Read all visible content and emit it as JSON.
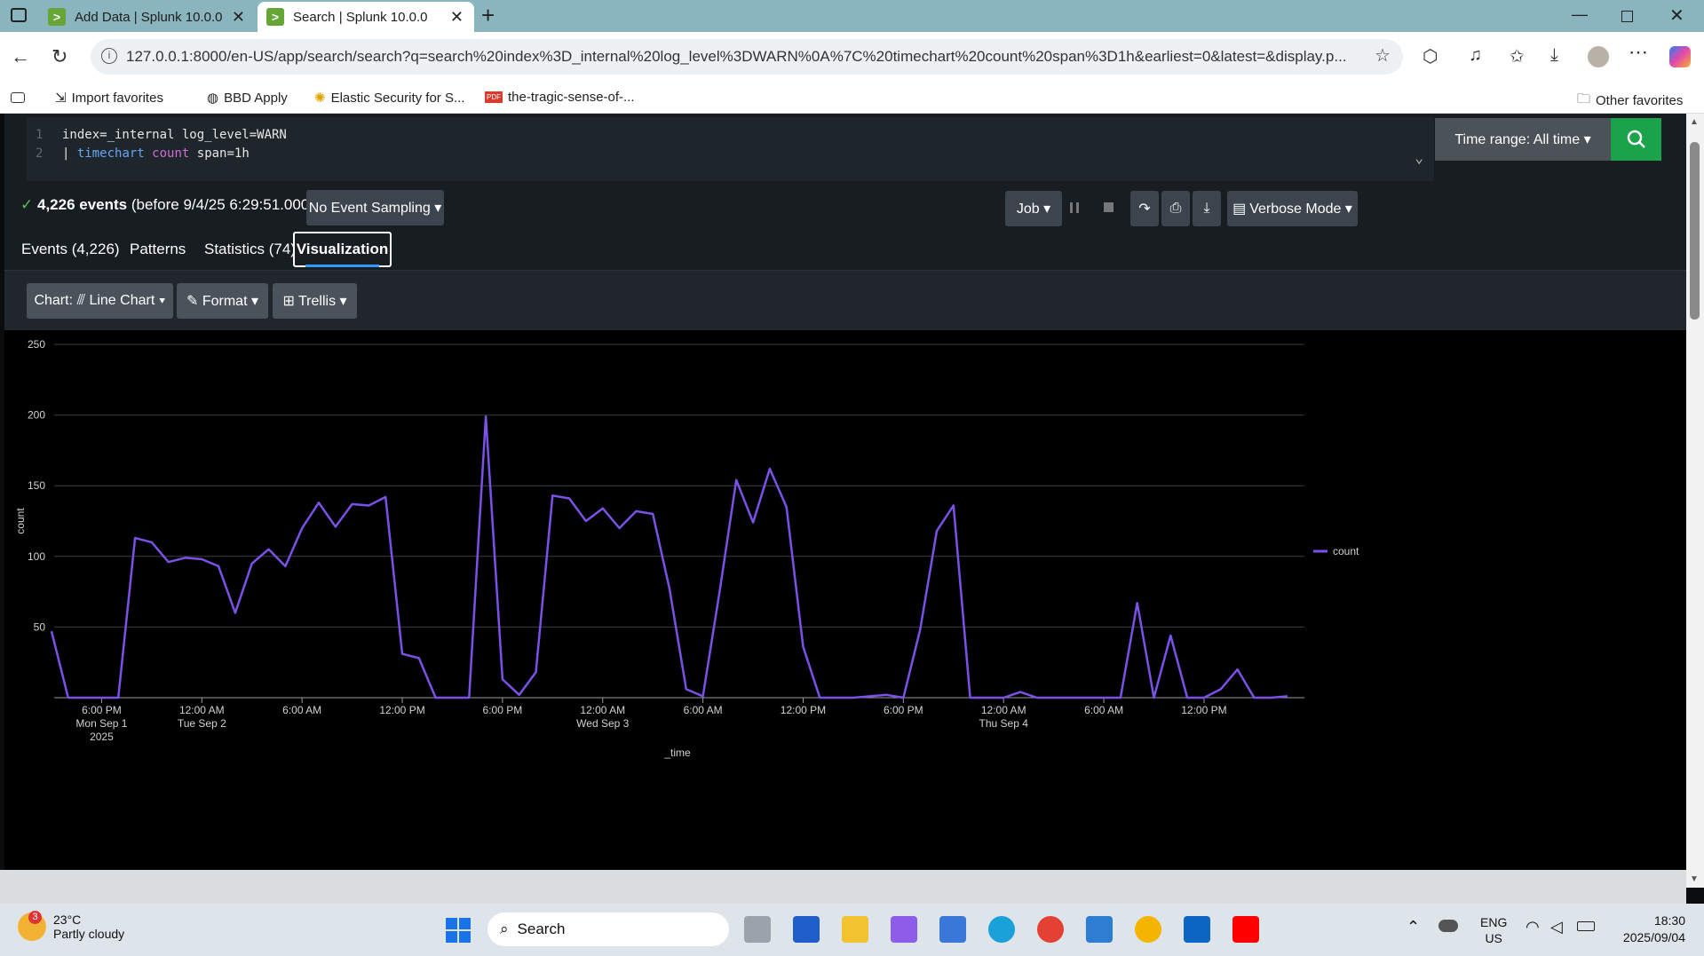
{
  "browser": {
    "tabs": [
      {
        "title": "Add Data | Splunk 10.0.0"
      },
      {
        "title": "Search | Splunk 10.0.0"
      }
    ],
    "url": "127.0.0.1:8000/en-US/app/search/search?q=search%20index%3D_internal%20log_level%3DWARN%0A%7C%20timechart%20count%20span%3D1h&earliest=0&latest=&display.p...",
    "bookmarks": [
      "Import favorites",
      "BBD Apply",
      "Elastic Security for S...",
      "the-tragic-sense-of-..."
    ],
    "other_favorites": "Other favorites"
  },
  "search": {
    "line1": "index=_internal log_level=WARN",
    "line2_pipe": "|",
    "line2_cmd": "timechart",
    "line2_arg": "count",
    "line2_rest": "span=1h",
    "time_range": "Time range: All time ▾"
  },
  "status": {
    "check": "✓",
    "events_bold": "4,226 events",
    "events_rest": "(before 9/4/25 6:29:51.000 PM)",
    "sampling": "No Event Sampling ▾",
    "job": "Job ▾",
    "mode": "Verbose Mode ▾"
  },
  "tabs": [
    "Events (4,226)",
    "Patterns",
    "Statistics (74)",
    "Visualization"
  ],
  "toolbar": {
    "chart": "Chart: ⫻ Line Chart ▾",
    "format": "✎ Format ▾",
    "trellis": "⊞ Trellis ▾"
  },
  "chart_data": {
    "type": "line",
    "xlabel": "_time",
    "ylabel": "count",
    "ylim": [
      0,
      250
    ],
    "yticks": [
      50,
      100,
      150,
      200,
      250
    ],
    "legend": "right",
    "grid": true,
    "color": "#7b52e8",
    "series": [
      {
        "name": "count",
        "values": [
          47,
          0,
          0,
          0,
          0,
          113,
          110,
          96,
          99,
          98,
          93,
          60,
          95,
          105,
          93,
          120,
          138,
          121,
          137,
          136,
          142,
          31,
          28,
          0,
          0,
          0,
          199,
          13,
          2,
          18,
          143,
          141,
          125,
          134,
          120,
          132,
          130,
          77,
          6,
          1,
          75,
          154,
          124,
          162,
          135,
          36,
          0,
          0,
          0,
          1,
          2,
          0,
          48,
          118,
          136,
          0,
          0,
          0,
          4,
          0,
          0,
          0,
          0,
          0,
          0,
          67,
          0,
          44,
          0,
          0,
          6,
          20,
          0,
          0,
          1
        ]
      }
    ],
    "xticks": [
      {
        "i": 3,
        "label": "6:00 PM",
        "sub": "Mon Sep 1",
        "sub2": "2025"
      },
      {
        "i": 9,
        "label": "12:00 AM",
        "sub": "Tue Sep 2",
        "sub2": ""
      },
      {
        "i": 15,
        "label": "6:00 AM",
        "sub": "",
        "sub2": ""
      },
      {
        "i": 21,
        "label": "12:00 PM",
        "sub": "",
        "sub2": ""
      },
      {
        "i": 27,
        "label": "6:00 PM",
        "sub": "",
        "sub2": ""
      },
      {
        "i": 33,
        "label": "12:00 AM",
        "sub": "Wed Sep 3",
        "sub2": ""
      },
      {
        "i": 39,
        "label": "6:00 AM",
        "sub": "",
        "sub2": ""
      },
      {
        "i": 45,
        "label": "12:00 PM",
        "sub": "",
        "sub2": ""
      },
      {
        "i": 51,
        "label": "6:00 PM",
        "sub": "",
        "sub2": ""
      },
      {
        "i": 57,
        "label": "12:00 AM",
        "sub": "Thu Sep 4",
        "sub2": ""
      },
      {
        "i": 63,
        "label": "6:00 AM",
        "sub": "",
        "sub2": ""
      },
      {
        "i": 69,
        "label": "12:00 PM",
        "sub": "",
        "sub2": ""
      }
    ]
  },
  "taskbar": {
    "temp": "23°C",
    "weather": "Partly cloudy",
    "badge": "3",
    "search": "Search",
    "lang1": "ENG",
    "lang2": "US",
    "time": "18:30",
    "date": "2025/09/04"
  }
}
